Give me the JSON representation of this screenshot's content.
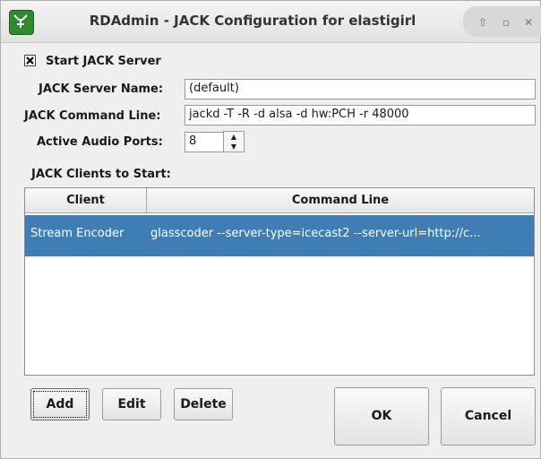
{
  "window": {
    "title": "RDAdmin - JACK Configuration for elastigirl",
    "controls": [
      "up-icon",
      "restore-icon",
      "close-icon"
    ]
  },
  "server": {
    "start_label": "Start JACK Server",
    "start_checked": true,
    "name_label": "JACK Server Name:",
    "name_value": "(default)",
    "cmd_label": "JACK Command Line:",
    "cmd_value": "jackd -T -R -d alsa -d hw:PCH -r 48000",
    "ports_label": "Active Audio Ports:",
    "ports_value": "8"
  },
  "clients": {
    "section_label": "JACK Clients to Start:",
    "columns": [
      "Client",
      "Command Line"
    ],
    "rows": [
      {
        "client": "Stream Encoder",
        "command": "glasscoder --server-type=icecast2 --server-url=http://c..."
      }
    ]
  },
  "buttons": {
    "add": "Add",
    "edit": "Edit",
    "delete": "Delete",
    "ok": "OK",
    "cancel": "Cancel"
  }
}
